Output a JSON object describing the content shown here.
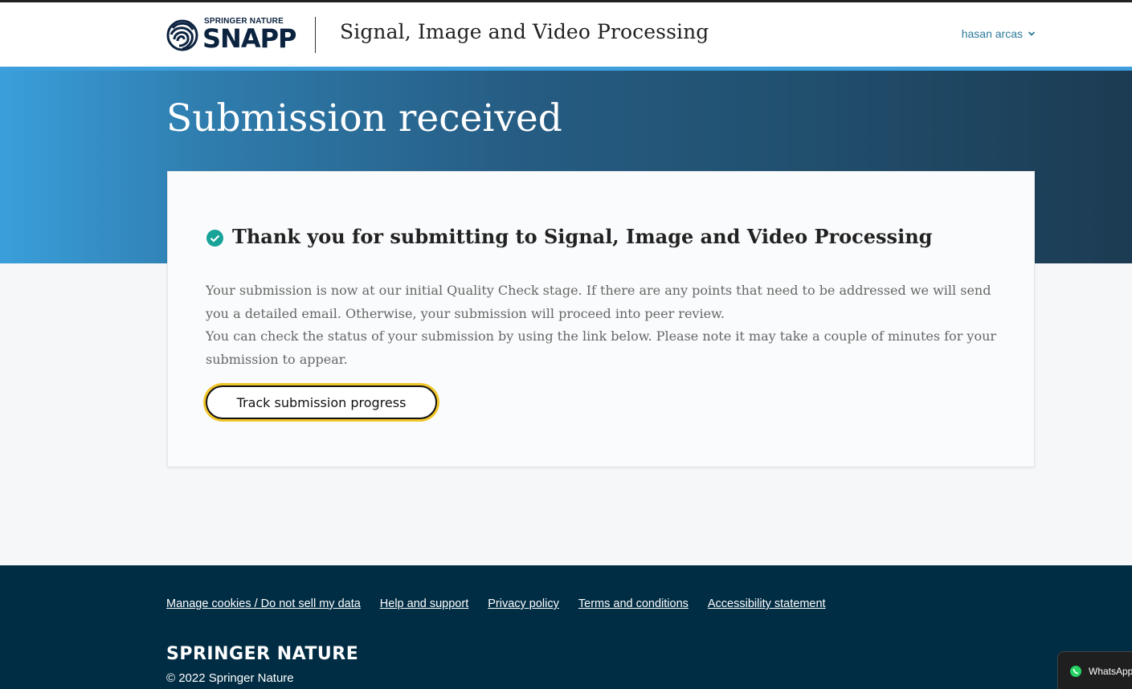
{
  "header": {
    "logo_brand": "SPRINGER NATURE",
    "logo_name": "SNAPP",
    "journal_title": "Signal, Image and Video Processing",
    "user_name": "hasan arcas"
  },
  "hero": {
    "title": "Submission received"
  },
  "card": {
    "heading": "Thank you for submitting to Signal, Image and Video Processing",
    "paragraph_1": "Your submission is now at our initial Quality Check stage. If there are any points that need to be addressed we will send you a detailed email. Otherwise, your submission will proceed into peer review.",
    "paragraph_2": "You can check the status of your submission by using the link below. Please note it may take a couple of minutes for your submission to appear.",
    "track_button": "Track submission progress"
  },
  "footer": {
    "links": [
      "Manage cookies / Do not sell my data",
      "Help and support",
      "Privacy policy",
      "Terms and conditions",
      "Accessibility statement"
    ],
    "brand": "SPRINGER NATURE",
    "copyright": "© 2022 Springer Nature"
  },
  "widget": {
    "label": "WhatsApp"
  },
  "colors": {
    "accent_teal": "#17a398",
    "link_blue": "#2d7a9a",
    "footer_bg": "#012d44",
    "focus_yellow": "#f0c62a"
  },
  "icons": {
    "logo": "snapp-fingerprint-icon",
    "user_menu": "chevron-down-icon",
    "success": "check-circle-icon",
    "widget": "whatsapp-icon"
  }
}
